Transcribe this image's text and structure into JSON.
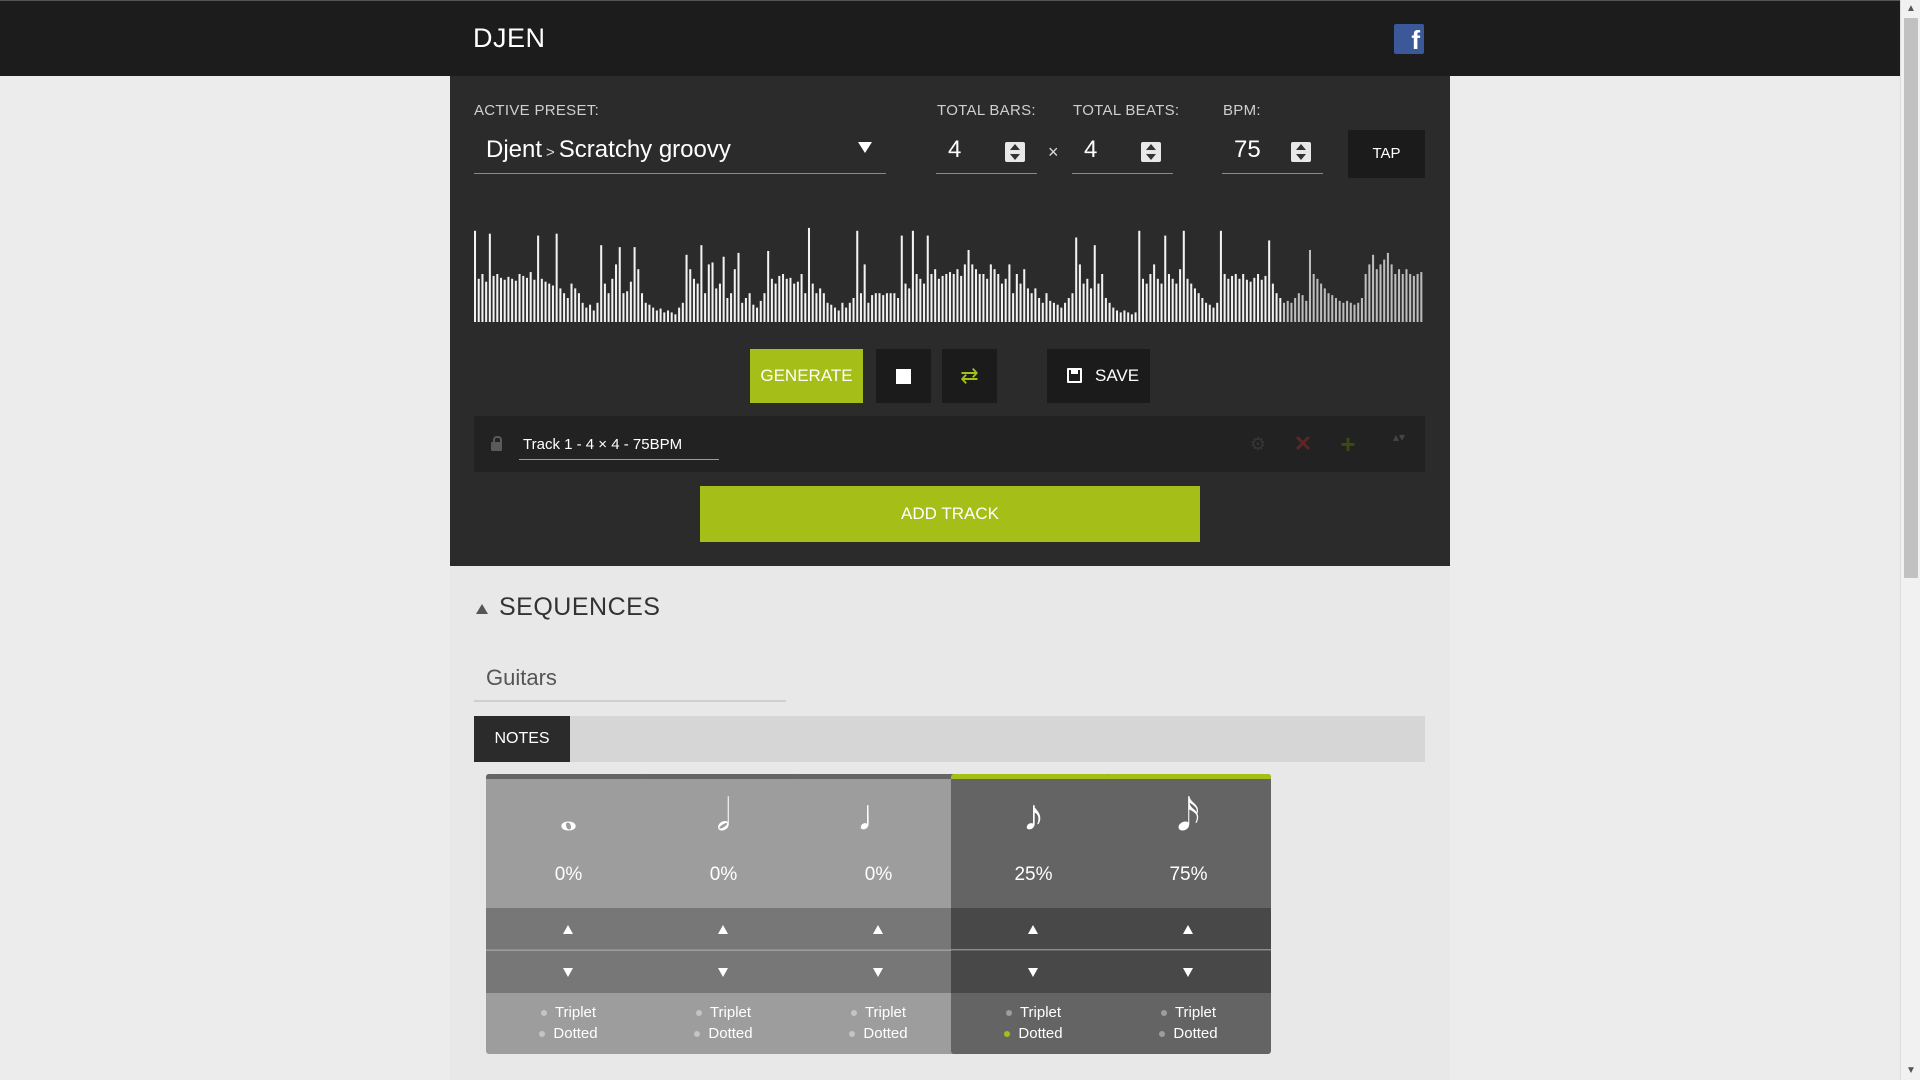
{
  "app": {
    "title": "DJEN",
    "social_icon": "facebook-icon",
    "social_glyph": "f"
  },
  "controls": {
    "active_preset_label": "ACTIVE PRESET:",
    "preset_category": "Djent",
    "preset_separator": ">",
    "preset_name": "Scratchy groovy",
    "total_bars_label": "TOTAL BARS:",
    "total_bars": "4",
    "times_symbol": "×",
    "total_beats_label": "TOTAL BEATS:",
    "total_beats": "4",
    "bpm_label": "BPM:",
    "bpm": "75",
    "tap_label": "TAP"
  },
  "waveform_heights": [
    0.95,
    0.45,
    0.5,
    0.42,
    0.92,
    0.48,
    0.5,
    0.46,
    0.44,
    0.47,
    0.45,
    0.43,
    0.5,
    0.48,
    0.46,
    0.52,
    0.44,
    0.9,
    0.45,
    0.42,
    0.4,
    0.38,
    0.92,
    0.35,
    0.3,
    0.25,
    0.4,
    0.35,
    0.3,
    0.2,
    0.15,
    0.18,
    0.12,
    0.2,
    0.8,
    0.4,
    0.3,
    0.45,
    0.6,
    0.78,
    0.3,
    0.32,
    0.42,
    0.78,
    0.55,
    0.3,
    0.2,
    0.18,
    0.15,
    0.12,
    0.14,
    0.1,
    0.12,
    0.1,
    0.08,
    0.15,
    0.2,
    0.7,
    0.55,
    0.45,
    0.4,
    0.8,
    0.3,
    0.6,
    0.62,
    0.35,
    0.4,
    0.68,
    0.25,
    0.3,
    0.55,
    0.72,
    0.2,
    0.25,
    0.3,
    0.18,
    0.15,
    0.22,
    0.3,
    0.74,
    0.45,
    0.4,
    0.48,
    0.5,
    0.45,
    0.46,
    0.4,
    0.42,
    0.5,
    0.3,
    0.98,
    0.4,
    0.3,
    0.35,
    0.3,
    0.2,
    0.18,
    0.15,
    0.12,
    0.2,
    0.15,
    0.2,
    0.25,
    0.95,
    0.3,
    0.6,
    0.2,
    0.28,
    0.3,
    0.3,
    0.28,
    0.3,
    0.3,
    0.3,
    0.25,
    0.9,
    0.4,
    0.35,
    0.95,
    0.5,
    0.45,
    0.4,
    0.9,
    0.5,
    0.55,
    0.45,
    0.48,
    0.5,
    0.52,
    0.5,
    0.55,
    0.48,
    0.6,
    0.75,
    0.6,
    0.55,
    0.5,
    0.5,
    0.45,
    0.6,
    0.55,
    0.5,
    0.4,
    0.45,
    0.6,
    0.3,
    0.5,
    0.4,
    0.55,
    0.35,
    0.3,
    0.35,
    0.25,
    0.2,
    0.3,
    0.22,
    0.2,
    0.18,
    0.15,
    0.2,
    0.25,
    0.3,
    0.88,
    0.6,
    0.4,
    0.45,
    0.35,
    0.8,
    0.4,
    0.5,
    0.25,
    0.2,
    0.15,
    0.12,
    0.1,
    0.12,
    0.1,
    0.08,
    0.1,
    0.95,
    0.45,
    0.4,
    0.5,
    0.6,
    0.45,
    0.4,
    0.9,
    0.5,
    0.45,
    0.4,
    0.55,
    0.95,
    0.45,
    0.4,
    0.35,
    0.3,
    0.25,
    0.2,
    0.18,
    0.15,
    0.2,
    0.95,
    0.5,
    0.45,
    0.48,
    0.5,
    0.45,
    0.5,
    0.44,
    0.42,
    0.46,
    0.5,
    0.44,
    0.48,
    0.85,
    0.4,
    0.3,
    0.25,
    0.2,
    0.22,
    0.2,
    0.25,
    0.3,
    0.28,
    0.22,
    0.75,
    0.5,
    0.45,
    0.4,
    0.35,
    0.3,
    0.28,
    0.25,
    0.22,
    0.2,
    0.22,
    0.2,
    0.18,
    0.2,
    0.25,
    0.5,
    0.6,
    0.7,
    0.55,
    0.6,
    0.65,
    0.72,
    0.6,
    0.5,
    0.55,
    0.5,
    0.55,
    0.5,
    0.48,
    0.5,
    0.52
  ],
  "actions": {
    "generate_label": "GENERATE",
    "save_label": "SAVE",
    "loop_glyph": "⇄"
  },
  "track": {
    "name": "Track 1 - 4 × 4 - 75BPM",
    "add_label": "ADD TRACK",
    "gear_glyph": "⚙",
    "delete_glyph": "✕",
    "add_glyph": "+",
    "move_glyph": "▴▾"
  },
  "sequences": {
    "title": "SEQUENCES",
    "instrument": "Guitars",
    "tab_label": "NOTES",
    "notes": [
      {
        "symbol": "𝅝",
        "pct": "0%",
        "triplet": "Triplet",
        "dotted": "Dotted",
        "active": false,
        "triplet_on": false,
        "dotted_on": false
      },
      {
        "symbol": "𝅗𝅥",
        "pct": "0%",
        "triplet": "Triplet",
        "dotted": "Dotted",
        "active": false,
        "triplet_on": false,
        "dotted_on": false
      },
      {
        "symbol": "♩",
        "pct": "0%",
        "triplet": "Triplet",
        "dotted": "Dotted",
        "active": false,
        "triplet_on": false,
        "dotted_on": false
      },
      {
        "symbol": "♪",
        "pct": "25%",
        "triplet": "Triplet",
        "dotted": "Dotted",
        "active": true,
        "triplet_on": false,
        "dotted_on": true
      },
      {
        "symbol": "𝅘𝅥𝅯",
        "pct": "75%",
        "triplet": "Triplet",
        "dotted": "Dotted",
        "active": true,
        "triplet_on": false,
        "dotted_on": false
      }
    ]
  },
  "colors": {
    "accent": "#a5be18",
    "panel": "#2b2b2b",
    "topbar": "#1c1c1c",
    "facebook": "#3b5998"
  }
}
